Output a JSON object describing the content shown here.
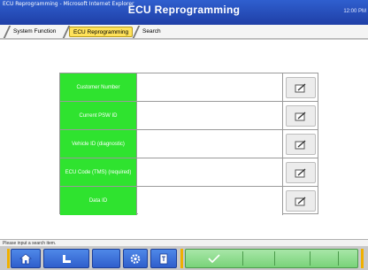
{
  "window": {
    "title": "ECU Reprogramming - Microsoft Internet Explorer",
    "app_title": "ECU Reprogramming",
    "clock": "12:00 PM"
  },
  "tabs": [
    {
      "label": "System Function",
      "active": false
    },
    {
      "label": "ECU Reprogramming",
      "active": true
    },
    {
      "label": "Search",
      "active": false
    }
  ],
  "rows": [
    {
      "label": "Customer Number",
      "value": ""
    },
    {
      "label": "Current PSW ID",
      "value": ""
    },
    {
      "label": "Vehicle ID (diagnostic)",
      "value": ""
    },
    {
      "label": "ECU Code (TMS) (required)",
      "value": ""
    },
    {
      "label": "Data ID",
      "value": ""
    }
  ],
  "status": {
    "message": "Please input a search item."
  },
  "toolbar": {
    "buttons": [
      {
        "icon": "home-icon"
      },
      {
        "icon": "return-icon"
      },
      {
        "icon": "settings-icon"
      },
      {
        "icon": "print-icon"
      },
      {
        "icon": "checkmark-icon"
      }
    ]
  },
  "colors": {
    "titlebar": "#2f5fcf",
    "label_green": "#2fe32f",
    "active_tab": "#ffe25a",
    "toolbar_blue": "#2f5fcc",
    "toolbar_green": "#6fcf6f"
  }
}
